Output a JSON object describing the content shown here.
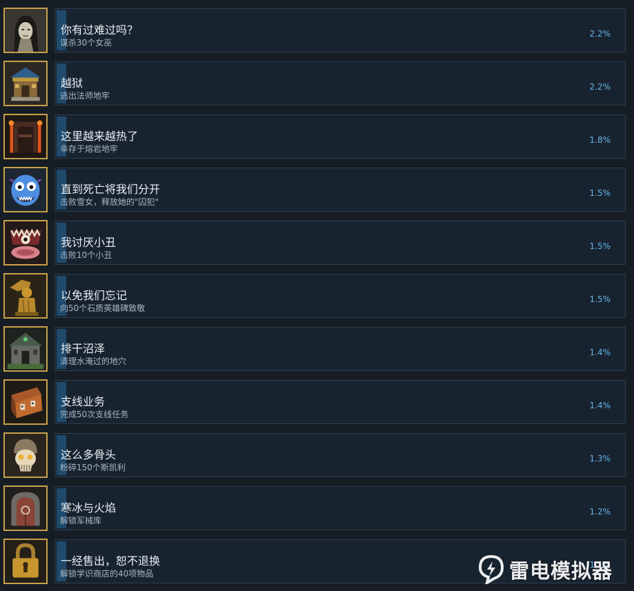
{
  "achievements": [
    {
      "title": "你有过难过吗？",
      "desc": "谋杀30个女巫",
      "pct": "2.2%",
      "progress": 0.022,
      "icon": "witch-portrait-icon"
    },
    {
      "title": "越狱",
      "desc": "逃出法师地牢",
      "pct": "2.2%",
      "progress": 0.022,
      "icon": "temple-building-icon"
    },
    {
      "title": "这里越来越热了",
      "desc": "幸存于熔岩地牢",
      "pct": "1.8%",
      "progress": 0.018,
      "icon": "lava-gate-icon"
    },
    {
      "title": "直到死亡将我们分开",
      "desc": "击败雪女，释放她的\"囚犯\"",
      "pct": "1.5%",
      "progress": 0.015,
      "icon": "blue-monster-icon"
    },
    {
      "title": "我讨厌小丑",
      "desc": "击败10个小丑",
      "pct": "1.5%",
      "progress": 0.015,
      "icon": "clown-monster-icon"
    },
    {
      "title": "以免我们忘记",
      "desc": "向50个石质英雄碑致敬",
      "pct": "1.5%",
      "progress": 0.015,
      "icon": "golden-statue-icon"
    },
    {
      "title": "排干沼泽",
      "desc": "清理水淹过的地穴",
      "pct": "1.4%",
      "progress": 0.014,
      "icon": "swamp-crypt-icon"
    },
    {
      "title": "支线业务",
      "desc": "完成50次支线任务",
      "pct": "1.4%",
      "progress": 0.014,
      "icon": "locked-chest-icon"
    },
    {
      "title": "这么多骨头",
      "desc": "粉碎150个斯凯利",
      "pct": "1.3%",
      "progress": 0.013,
      "icon": "skull-warrior-icon"
    },
    {
      "title": "寒冰与火焰",
      "desc": "解锁军械库",
      "pct": "1.2%",
      "progress": 0.012,
      "icon": "armory-door-icon"
    },
    {
      "title": "一经售出，恕不退换",
      "desc": "解锁学识商店的40项物品",
      "pct": "1.1%",
      "progress": 0.011,
      "icon": "padlock-icon"
    }
  ],
  "watermark": {
    "text": "雷电模拟器",
    "icon": "leidian-logo-icon"
  }
}
